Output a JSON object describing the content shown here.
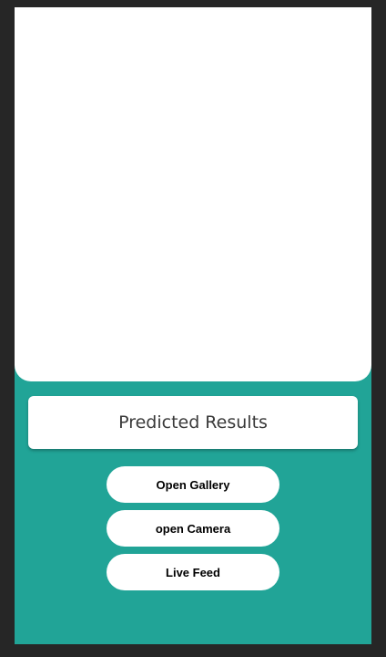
{
  "result_card": {
    "text": "Predicted Results"
  },
  "buttons": {
    "open_gallery": "Open Gallery",
    "open_camera": "open Camera",
    "live_feed": "Live Feed"
  },
  "colors": {
    "background": "#262626",
    "accent": "#21A497",
    "card": "#FFFFFF"
  }
}
